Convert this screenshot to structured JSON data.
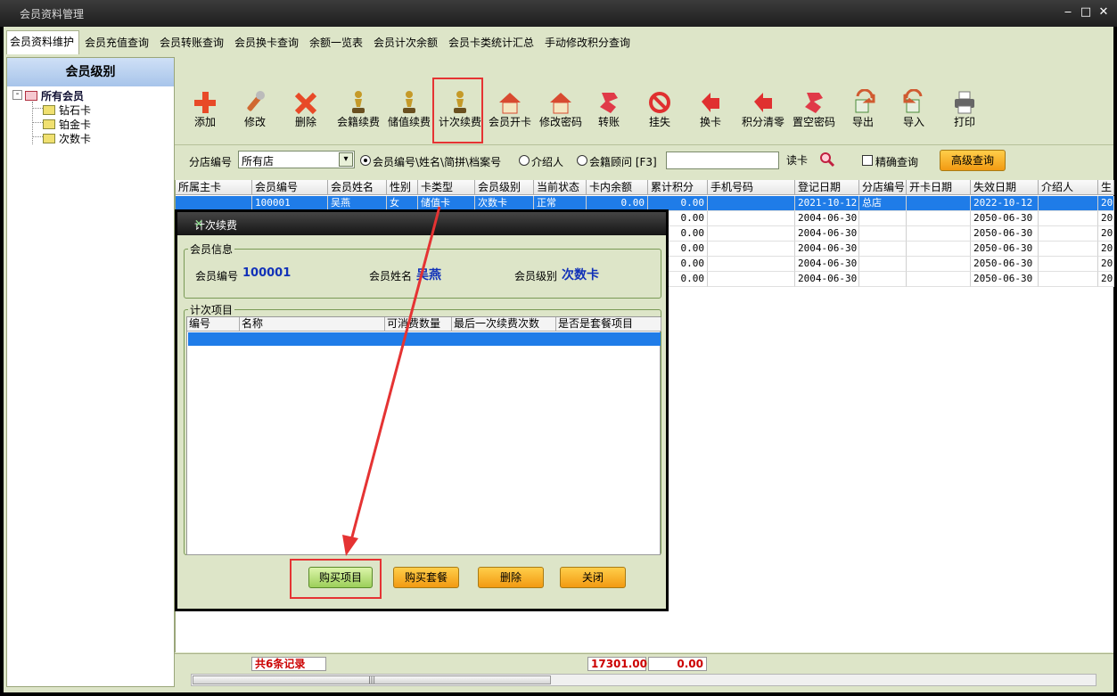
{
  "window": {
    "title": "会员资料管理",
    "min": "‒",
    "max": "□",
    "close": "✕"
  },
  "tabs": [
    "会员资料维护",
    "会员充值查询",
    "会员转账查询",
    "会员换卡查询",
    "余额一览表",
    "会员计次余额",
    "会员卡类统计汇总",
    "手动修改积分查询"
  ],
  "sidebar": {
    "title": "会员级别",
    "root": "所有会员",
    "items": [
      "钻石卡",
      "铂金卡",
      "次数卡"
    ],
    "expander": "-"
  },
  "toolbar": [
    {
      "label": "添加",
      "icon": "add-icon",
      "color": "#e84a28"
    },
    {
      "label": "修改",
      "icon": "wrench-icon",
      "color": "#d06830"
    },
    {
      "label": "删除",
      "icon": "delete-x-icon",
      "color": "#e84a28"
    },
    {
      "label": "会籍续费",
      "icon": "pawn-icon",
      "color": "#c59a28"
    },
    {
      "label": "储值续费",
      "icon": "pawn-icon",
      "color": "#c59a28"
    },
    {
      "label": "计次续费",
      "icon": "pawn-icon",
      "color": "#c59a28"
    },
    {
      "label": "会员开卡",
      "icon": "house-icon",
      "color": "#d84a30"
    },
    {
      "label": "修改密码",
      "icon": "house-icon",
      "color": "#d84a30"
    },
    {
      "label": "转账",
      "icon": "transfer-icon",
      "color": "#e03a48"
    },
    {
      "label": "挂失",
      "icon": "prohibit-icon",
      "color": "#e03030"
    },
    {
      "label": "换卡",
      "icon": "arrow-back-icon",
      "color": "#e03030"
    },
    {
      "label": "积分清零",
      "icon": "arrow-back-icon",
      "color": "#e03030"
    },
    {
      "label": "置空密码",
      "icon": "transfer-icon",
      "color": "#e03a48"
    },
    {
      "label": "导出",
      "icon": "export-icon",
      "color": "#d05a30"
    },
    {
      "label": "导入",
      "icon": "import-icon",
      "color": "#d05a30"
    },
    {
      "label": "打印",
      "icon": "printer-icon",
      "color": "#666666"
    }
  ],
  "filter": {
    "branch_label": "分店编号",
    "branch_value": "所有店",
    "radio1": "会员编号\\姓名\\简拼\\档案号",
    "radio2": "介绍人",
    "radio3": "会籍顾问 [F3]",
    "search_value": "",
    "read_card": "读卡",
    "exact_query": "精确查询",
    "advanced": "高级查询"
  },
  "grid": {
    "columns": [
      "所属主卡",
      "会员编号",
      "会员姓名",
      "性别",
      "卡类型",
      "会员级别",
      "当前状态",
      "卡内余额",
      "累计积分",
      "手机号码",
      "登记日期",
      "分店编号",
      "开卡日期",
      "失效日期",
      "介绍人",
      "生"
    ],
    "rows": [
      [
        "",
        "100001",
        "吴燕",
        "女",
        "储值卡",
        "次数卡",
        "正常",
        "0.00",
        "0.00",
        "",
        "2021-10-12",
        "总店",
        "",
        "2022-10-12",
        "",
        "20"
      ],
      [
        "",
        "",
        "",
        "",
        "",
        "",
        "",
        "",
        "0.00",
        "",
        "2004-06-30",
        "",
        "",
        "2050-06-30",
        "",
        "20"
      ],
      [
        "",
        "",
        "",
        "",
        "",
        "",
        "",
        "",
        "0.00",
        "",
        "2004-06-30",
        "",
        "",
        "2050-06-30",
        "",
        "20"
      ],
      [
        "",
        "",
        "",
        "",
        "",
        "",
        "",
        "",
        "0.00",
        "",
        "2004-06-30",
        "",
        "",
        "2050-06-30",
        "",
        "20"
      ],
      [
        "",
        "",
        "",
        "",
        "",
        "",
        "",
        "",
        "0.00",
        "",
        "2004-06-30",
        "",
        "",
        "2050-06-30",
        "",
        "20"
      ],
      [
        "",
        "",
        "",
        "",
        "",
        "",
        "",
        "",
        "0.00",
        "",
        "2004-06-30",
        "",
        "",
        "2050-06-30",
        "",
        "20"
      ]
    ]
  },
  "status": {
    "records": "共6条记录",
    "balance_total": "17301.00",
    "points_total": "0.00",
    "scroll_grip": "|||"
  },
  "dialog": {
    "title": "计次续费",
    "close": "✕",
    "member_info_legend": "会员信息",
    "member_no_label": "会员编号",
    "member_no": "100001",
    "member_name_label": "会员姓名",
    "member_name": "吴燕",
    "member_level_label": "会员级别",
    "member_level": "次数卡",
    "items_legend": "计次项目",
    "items_columns": [
      "编号",
      "名称",
      "可消费数量",
      "最后一次续费次数",
      "是否是套餐项目"
    ],
    "buttons": [
      "购买项目",
      "购买套餐",
      "删除",
      "关闭"
    ]
  },
  "colors": {
    "accent": "#1f7ce8",
    "highlight": "#e53333",
    "panel": "#dde5c8"
  }
}
